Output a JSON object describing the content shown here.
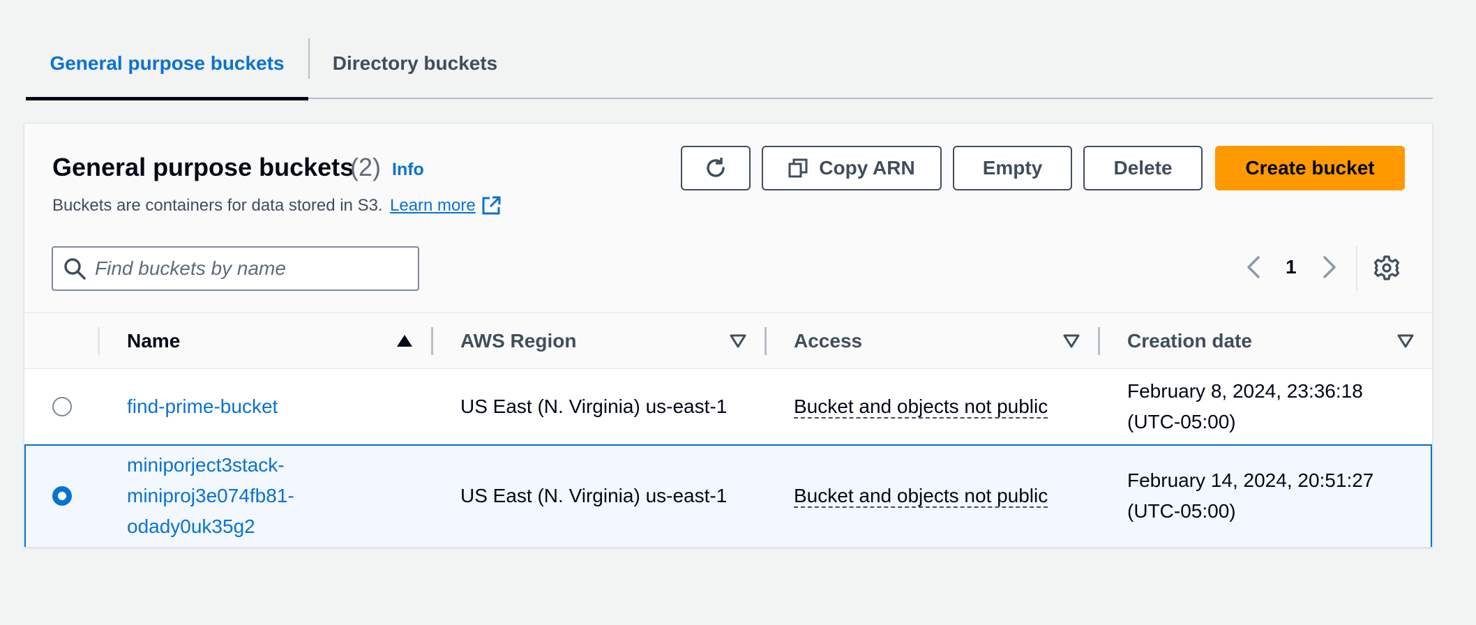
{
  "tabs": {
    "general": "General purpose buckets",
    "directory": "Directory buckets"
  },
  "header": {
    "title": "General purpose buckets",
    "count": "(2)",
    "info": "Info",
    "description": "Buckets are containers for data stored in S3.",
    "learn_more": "Learn more"
  },
  "actions": {
    "copy_arn": "Copy ARN",
    "empty": "Empty",
    "delete": "Delete",
    "create_bucket": "Create bucket"
  },
  "search": {
    "placeholder": "Find buckets by name"
  },
  "pagination": {
    "current_page": "1"
  },
  "table": {
    "columns": [
      "Name",
      "AWS Region",
      "Access",
      "Creation date"
    ],
    "rows": [
      {
        "name": "find-prime-bucket",
        "name_lines": [
          "find-prime-bucket"
        ],
        "region": "US East (N. Virginia) us-east-1",
        "access": "Bucket and objects not public",
        "created_line1": "February 8, 2024, 23:36:18",
        "created_line2": "(UTC-05:00)",
        "selected": false
      },
      {
        "name": "miniporject3stack-miniproj3e074fb81-odady0uk35g2",
        "name_lines": [
          "miniporject3stack-",
          "miniproj3e074fb81-",
          "odady0uk35g2"
        ],
        "region": "US East (N. Virginia) us-east-1",
        "access": "Bucket and objects not public",
        "created_line1": "February 14, 2024, 20:51:27",
        "created_line2": "(UTC-05:00)",
        "selected": true
      }
    ]
  },
  "colors": {
    "accent": "#0972d3",
    "primary_button": "#ff9900",
    "selected_row": "#f2f8fd"
  }
}
